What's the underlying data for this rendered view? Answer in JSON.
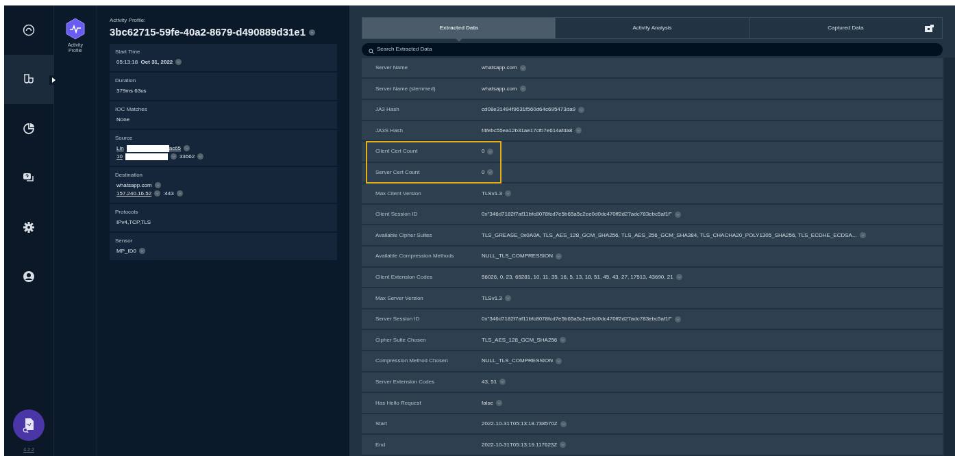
{
  "nav": [
    {
      "selected": false
    },
    {
      "selected": true
    },
    {
      "selected": false
    },
    {
      "selected": false
    },
    {
      "selected": false
    },
    {
      "selected": false
    }
  ],
  "version": "4.2.2",
  "profile_badge": {
    "label": "Activity Profile"
  },
  "profile": {
    "caption": "Activity Profile:",
    "id": "3bc62715-59fe-40a2-8679-d490889d31e1"
  },
  "details": [
    {
      "label": "Start Time",
      "lines": [
        [
          {
            "kind": "text",
            "text": "05:13:18  **Oct 31, 2022**"
          },
          {
            "kind": "copy"
          }
        ]
      ]
    },
    {
      "label": "Duration",
      "lines": [
        [
          {
            "kind": "text",
            "text": "379ms 63us"
          }
        ]
      ]
    },
    {
      "label": "IOC Matches",
      "lines": [
        [
          {
            "kind": "text",
            "text": "None"
          }
        ]
      ]
    },
    {
      "label": "Source",
      "lines": [
        [
          {
            "kind": "link",
            "text": "Lin"
          },
          {
            "kind": "redaction"
          },
          {
            "kind": "link",
            "text": "ac65"
          },
          {
            "kind": "copy"
          }
        ],
        [
          {
            "kind": "link",
            "text": "10"
          },
          {
            "kind": "redaction"
          },
          {
            "kind": "copy"
          },
          {
            "kind": "text",
            "text": "33662"
          },
          {
            "kind": "copy"
          }
        ]
      ]
    },
    {
      "label": "Destination",
      "lines": [
        [
          {
            "kind": "text",
            "text": "whatsapp.com"
          },
          {
            "kind": "copy"
          }
        ],
        [
          {
            "kind": "link",
            "text": "157.240.16.52"
          },
          {
            "kind": "copy"
          },
          {
            "kind": "text",
            "text": ":443"
          },
          {
            "kind": "copy"
          }
        ]
      ]
    },
    {
      "label": "Protocols",
      "lines": [
        [
          {
            "kind": "text",
            "text": "IPv4,TCP,TLS"
          }
        ]
      ]
    },
    {
      "label": "Sensor",
      "lines": [
        [
          {
            "kind": "text",
            "text": "MP_ID0"
          },
          {
            "kind": "copy"
          }
        ]
      ]
    }
  ],
  "tabs": [
    {
      "label": "Extracted Data",
      "selected": true
    },
    {
      "label": "Activity Analysis",
      "selected": false
    },
    {
      "label": "Captured Data",
      "selected": false
    }
  ],
  "search": {
    "placeholder": "Search Extracted Data"
  },
  "rows": [
    {
      "label": "Server Name",
      "value": "whatsapp.com",
      "highlighted": false
    },
    {
      "label": "Server Name (stemmed)",
      "value": "whatsapp.com",
      "highlighted": false
    },
    {
      "label": "JA3 Hash",
      "value": "cd08e31494f9631f560d64c695473da9",
      "highlighted": false
    },
    {
      "label": "JA3S Hash",
      "value": "f4febc55ea12b31ae17cfb7e614afda8",
      "highlighted": false
    },
    {
      "label": "Client Cert Count",
      "value": "0",
      "highlighted": true
    },
    {
      "label": "Server Cert Count",
      "value": "0",
      "highlighted": true
    },
    {
      "label": "Max Client Version",
      "value": "TLSv1.3",
      "highlighted": false
    },
    {
      "label": "Client Session ID",
      "value": "0x\"346d7182f7af11bfc8078fcd7e5b65a5c2ee0d0dc470ff2d27adc783ebc5af1f\"",
      "highlighted": false
    },
    {
      "label": "Available Cipher Suites",
      "value": "TLS_GREASE_0x0A0A, TLS_AES_128_GCM_SHA256, TLS_AES_256_GCM_SHA384, TLS_CHACHA20_POLY1305_SHA256, TLS_ECDHE_ECDSA...",
      "highlighted": false
    },
    {
      "label": "Available Compression Methods",
      "value": "NULL_TLS_COMPRESSION",
      "highlighted": false
    },
    {
      "label": "Client Extension Codes",
      "value": "56026, 0, 23, 65281, 10, 11, 35, 16, 5, 13, 18, 51, 45, 43, 27, 17513, 43690, 21",
      "highlighted": false
    },
    {
      "label": "Max Server Version",
      "value": "TLSv1.3",
      "highlighted": false
    },
    {
      "label": "Server Session ID",
      "value": "0x\"346d7182f7af11bfc8078fcd7e5b65a5c2ee0d0dc470ff2d27adc783ebc5af1f\"",
      "highlighted": false
    },
    {
      "label": "Cipher Suite Chosen",
      "value": "TLS_AES_128_GCM_SHA256",
      "highlighted": false
    },
    {
      "label": "Compression Method Chosen",
      "value": "NULL_TLS_COMPRESSION",
      "highlighted": false
    },
    {
      "label": "Server Extension Codes",
      "value": "43, 51",
      "highlighted": false
    },
    {
      "label": "Has Hello Request",
      "value": "false",
      "highlighted": false
    },
    {
      "label": "Start",
      "value": "2022-10-31T05:13:18.738570Z",
      "highlighted": false
    },
    {
      "label": "End",
      "value": "2022-10-31T05:13:19.117623Z",
      "highlighted": false
    }
  ]
}
